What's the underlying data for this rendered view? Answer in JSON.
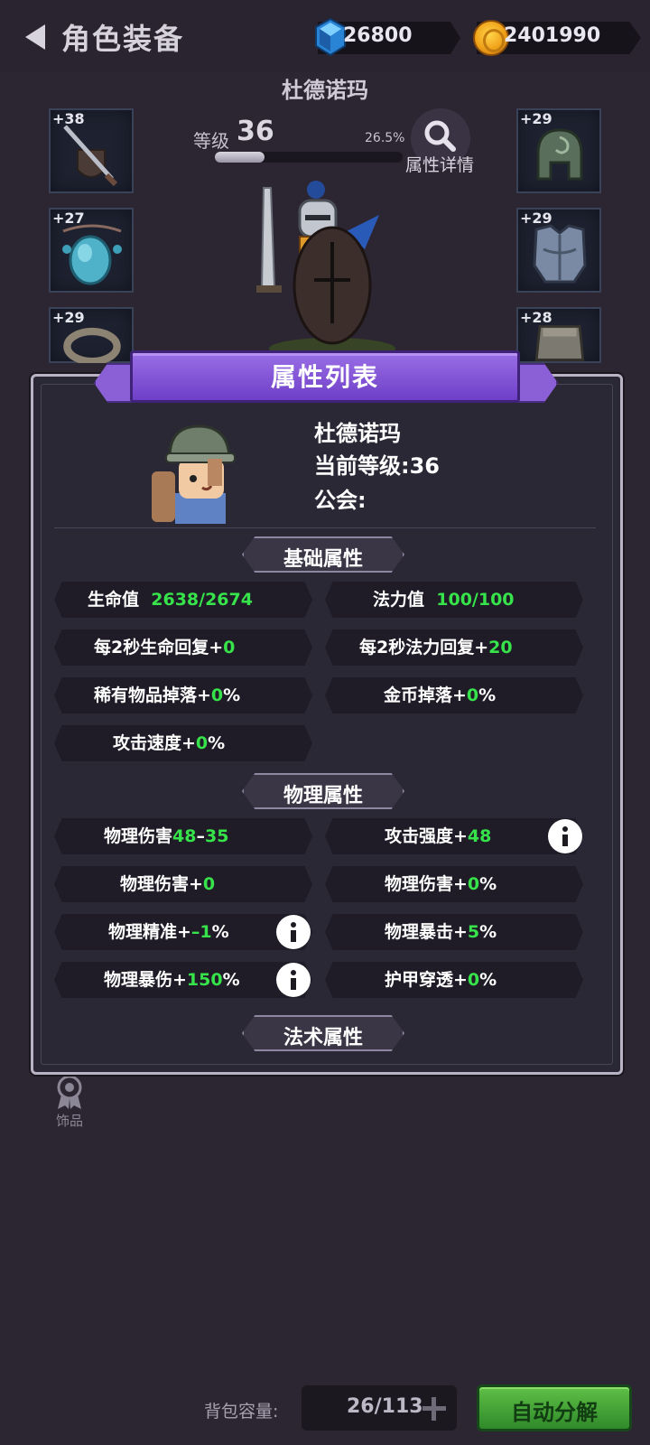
{
  "header": {
    "title": "角色装备",
    "gems": "26800",
    "gold": "2401990"
  },
  "character": {
    "name": "杜德诺玛",
    "level_label": "等级",
    "level": "36",
    "exp_percent": "26.5%",
    "exp_fraction": 0.265,
    "detail_label": "属性详情"
  },
  "slots": {
    "left": [
      "+38",
      "+27",
      "+29"
    ],
    "right": [
      "+29",
      "+29",
      "+28"
    ]
  },
  "side_labels": {
    "ring": "戒指",
    "accessory": "饰品"
  },
  "panel": {
    "title": "属性列表",
    "name": "杜德诺玛",
    "current_level": "当前等级:36",
    "guild": "公会:",
    "sections": {
      "basic": "基础属性",
      "physical": "物理属性",
      "magic": "法术属性"
    },
    "basic": {
      "hp_label": "生命值",
      "hp_value": "2638/2674",
      "mp_label": "法力值",
      "mp_value": "100/100",
      "hp_regen_label": "每2秒生命回复+",
      "hp_regen_value": "0",
      "mp_regen_label": "每2秒法力回复+",
      "mp_regen_value": "20",
      "rare_drop_label": "稀有物品掉落+",
      "rare_drop_value": "0",
      "gold_drop_label": "金币掉落+",
      "gold_drop_value": "0",
      "attack_speed_label": "攻击速度+",
      "attack_speed_value": "0",
      "percent": "%"
    },
    "physical": {
      "phys_dmg_label": "物理伤害",
      "phys_dmg_min": "48",
      "phys_dmg_sep": "–",
      "phys_dmg_max": "35",
      "attack_power_label": "攻击强度+",
      "attack_power_value": "48",
      "phys_dmg_flat_label": "物理伤害+",
      "phys_dmg_flat_value": "0",
      "phys_dmg_pct_label": "物理伤害+",
      "phys_dmg_pct_value": "0",
      "accuracy_label": "物理精准+",
      "accuracy_value": "–1",
      "crit_label": "物理暴击+",
      "crit_value": "5",
      "crit_dmg_label": "物理暴伤+",
      "crit_dmg_value": "150",
      "armor_pen_label": "护甲穿透+",
      "armor_pen_value": "0",
      "percent": "%"
    }
  },
  "bottom": {
    "bag_label": "背包容量:",
    "bag_value": "26/113",
    "auto_button": "自动分解"
  },
  "colors": {
    "background": "#2c2532",
    "ribbon": "#7b4fd6",
    "green_value": "#37e34a",
    "auto_button": "#4caa3a"
  }
}
